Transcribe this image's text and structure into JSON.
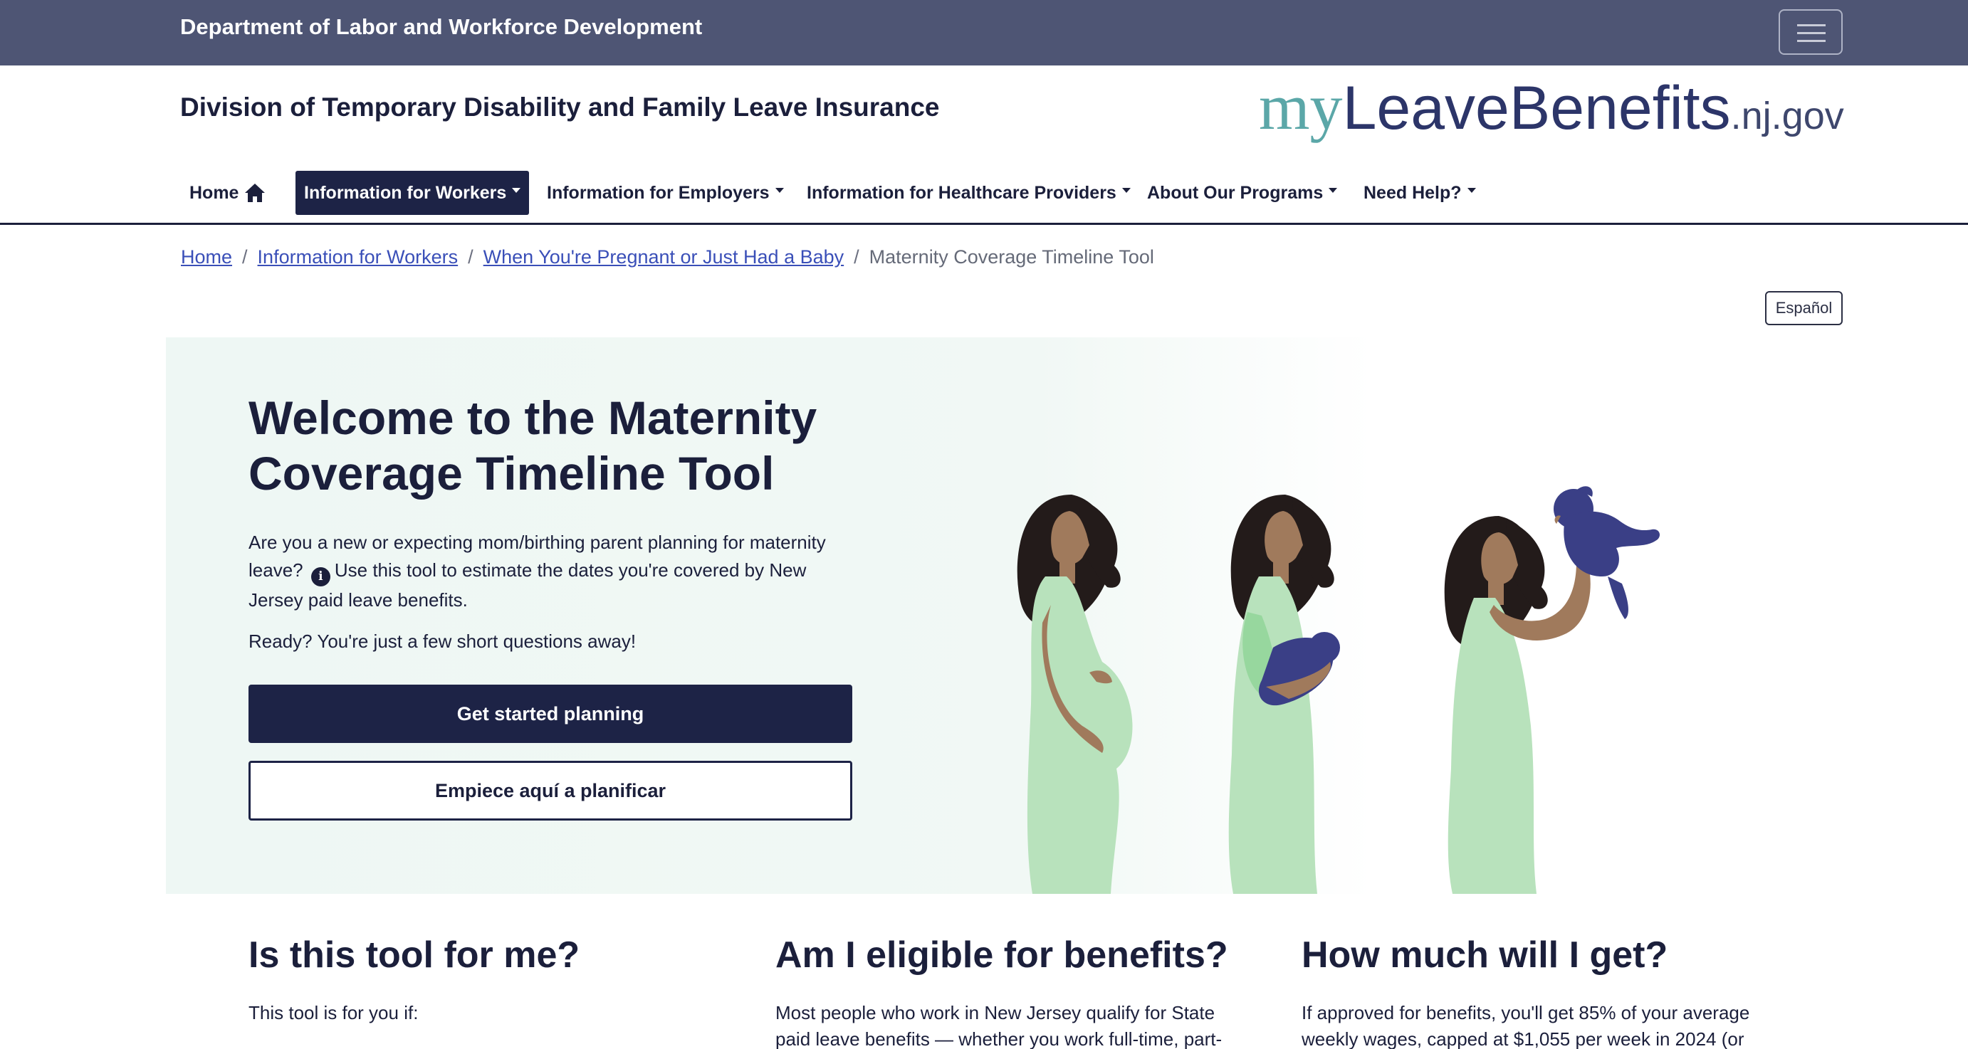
{
  "topbar": {
    "title": "Department of Labor and Workforce Development"
  },
  "header": {
    "division": "Division of Temporary Disability and Family Leave Insurance",
    "logo": {
      "part1": "my",
      "part2": "LeaveBenefits",
      "part3": ".nj.gov"
    }
  },
  "nav": {
    "items": [
      {
        "label": "Home"
      },
      {
        "label": "Information for Workers"
      },
      {
        "label": "Information for Employers"
      },
      {
        "label": "Information for Healthcare Providers"
      },
      {
        "label": "About Our Programs"
      },
      {
        "label": "Need Help?"
      }
    ]
  },
  "breadcrumb": {
    "items": [
      "Home",
      "Information for Workers",
      "When You're Pregnant or Just Had a Baby"
    ],
    "current": "Maternity Coverage Timeline Tool"
  },
  "language_button": "Español",
  "hero": {
    "title": "Welcome to the Maternity Coverage Timeline Tool",
    "intro_before": "Are you a new or expecting mom/birthing parent planning for maternity leave?",
    "intro_after": "Use this tool to estimate the dates you're covered by New Jersey paid leave benefits.",
    "ready": "Ready? You're just a few short questions away!",
    "primary_button": "Get started planning",
    "secondary_button": "Empiece aquí a planificar"
  },
  "columns": [
    {
      "title": "Is this tool for me?",
      "text": "This tool is for you if:"
    },
    {
      "title": "Am I eligible for benefits?",
      "text": "Most people who work in New Jersey qualify for State paid leave benefits — whether you work full-time, part-"
    },
    {
      "title": "How much will I get?",
      "text": "If approved for benefits, you'll get 85% of your average weekly wages, capped at $1,055 per week in 2024 (or"
    }
  ],
  "colors": {
    "topbar": "#4e5574",
    "navy": "#1d2346",
    "link": "#3a4fb8",
    "hero_bg": "#eef7f4",
    "dress": "#b8e2bc",
    "skin": "#a07a5c",
    "baby": "#3a3f86"
  }
}
